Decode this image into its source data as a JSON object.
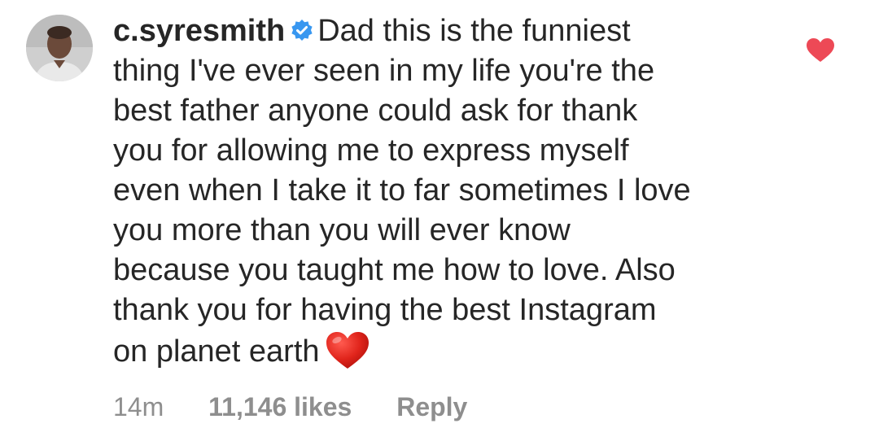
{
  "comment": {
    "avatar_icon": "user-avatar",
    "username": "c.syresmith",
    "verified_icon": "verified-badge-icon",
    "verified_color": "#3897f0",
    "lines": [
      "Dad this is the funniest",
      "thing I've ever seen in my life you're the",
      "best father anyone could ask for thank",
      "you for allowing me to express myself",
      "even when I take it to far sometimes I love",
      "you more than you will ever know",
      "because you taught me how to love. Also",
      "thank you for having the best Instagram",
      "on planet earth"
    ],
    "emoji_icon": "red-heart-emoji",
    "heart_color": "#ed4956",
    "like_icon": "heart-icon",
    "time": "14m",
    "likes": "11,146 likes",
    "reply_label": "Reply"
  }
}
